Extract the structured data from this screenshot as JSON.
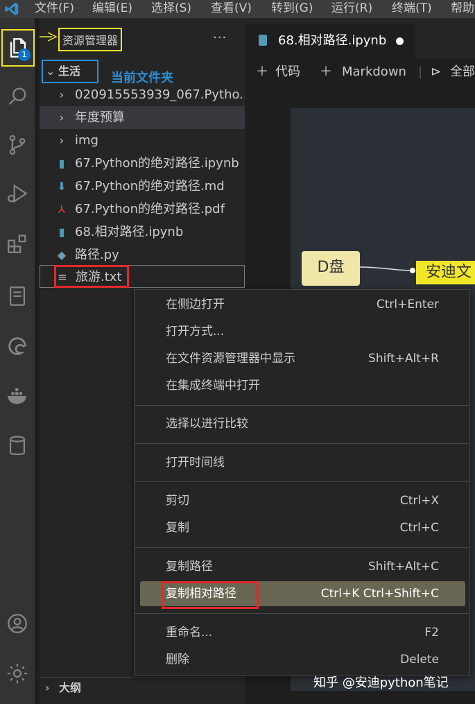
{
  "menu": [
    "文件(F)",
    "编辑(E)",
    "选择(S)",
    "查看(V)",
    "转到(G)",
    "运行(R)",
    "终端(T)",
    "帮助"
  ],
  "activity": {
    "explorer_badge": "1"
  },
  "sidebar": {
    "title": "资源管理器",
    "more": "···",
    "folder": "生活",
    "annotation": "当前文件夹",
    "items": [
      {
        "label": "020915553939_067.Pytho...",
        "icon": "chevron-right-icon",
        "symbol": "›"
      },
      {
        "label": "年度预算",
        "icon": "chevron-right-icon",
        "symbol": "›"
      },
      {
        "label": "img",
        "icon": "chevron-right-icon",
        "symbol": "›"
      },
      {
        "label": "67.Python的绝对路径.ipynb",
        "icon": "notebook-file-icon",
        "symbol": "▮"
      },
      {
        "label": "67.Python的绝对路径.md",
        "icon": "markdown-file-icon",
        "symbol": "⬇"
      },
      {
        "label": "67.Python的绝对路径.pdf",
        "icon": "pdf-file-icon",
        "symbol": "⅄"
      },
      {
        "label": "68.相对路径.ipynb",
        "icon": "notebook-file-icon",
        "symbol": "▮"
      },
      {
        "label": "路径.py",
        "icon": "python-file-icon",
        "symbol": "◆"
      },
      {
        "label": "旅游.txt",
        "icon": "text-file-icon",
        "symbol": "≡"
      }
    ],
    "outline": "大纲"
  },
  "editor": {
    "tab": "68.相对路径.ipynb",
    "toolbar": {
      "code": "代码",
      "markdown": "Markdown",
      "run_all": "全部"
    },
    "nodes": {
      "d": "D盘",
      "a": "安迪文"
    }
  },
  "context_menu": {
    "groups": [
      [
        {
          "label": "在侧边打开",
          "key": "Ctrl+Enter"
        },
        {
          "label": "打开方式...",
          "key": ""
        },
        {
          "label": "在文件资源管理器中显示",
          "key": "Shift+Alt+R"
        },
        {
          "label": "在集成终端中打开",
          "key": ""
        }
      ],
      [
        {
          "label": "选择以进行比较",
          "key": ""
        }
      ],
      [
        {
          "label": "打开时间线",
          "key": ""
        }
      ],
      [
        {
          "label": "剪切",
          "key": "Ctrl+X"
        },
        {
          "label": "复制",
          "key": "Ctrl+C"
        }
      ],
      [
        {
          "label": "复制路径",
          "key": "Shift+Alt+C"
        },
        {
          "label": "复制相对路径",
          "key": "Ctrl+K Ctrl+Shift+C"
        }
      ],
      [
        {
          "label": "重命名...",
          "key": "F2"
        },
        {
          "label": "删除",
          "key": "Delete"
        }
      ]
    ]
  },
  "watermark": "知乎 @安迪python笔记",
  "colors": {
    "annotation_yellow": "#f2e629",
    "annotation_blue": "#2d8fd8",
    "annotation_red": "#e32929",
    "highlight": "#6a6654"
  }
}
